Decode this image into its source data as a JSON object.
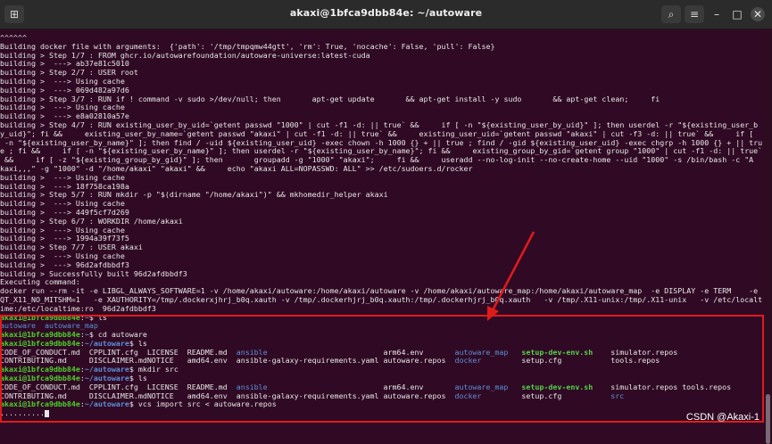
{
  "window": {
    "title": "akaxi@1bfca9dbb84e: ~/autoware"
  },
  "colors": {
    "bg": "#300a24",
    "user": "#4cd12a",
    "path": "#5d8fd9",
    "highlight": "#e01b1b"
  },
  "titlebar": {
    "new_tab_icon": "terminal-tab-icon",
    "search_icon": "search-icon",
    "menu_icon": "hamburger-menu-icon",
    "minimize_icon": "minimize-icon",
    "maximize_icon": "maximize-icon",
    "close_icon": "close-icon"
  },
  "terminal": {
    "log_lines": [
      "^^^^^^",
      "Building docker file with arguments:  {'path': '/tmp/tmpqmw44gtt', 'rm': True, 'nocache': False, 'pull': False}",
      "building > Step 1/7 : FROM ghcr.io/autowarefoundation/autoware-universe:latest-cuda",
      "building >  ---> ab37e81c5010",
      "building > Step 2/7 : USER root",
      "building >  ---> Using cache",
      "building >  ---> 069d482a97d6",
      "building > Step 3/7 : RUN if ! command -v sudo >/dev/null; then       apt-get update       && apt-get install -y sudo       && apt-get clean;     fi",
      "building >  ---> Using cache",
      "building >  ---> e8a02810a57e",
      "building > Step 4/7 : RUN existing_user_by_uid=`getent passwd \"1000\" | cut -f1 -d: || true` &&     if [ -n \"${existing_user_by_uid}\" ]; then userdel -r \"${existing_user_b",
      "y_uid}\"; fi &&     existing_user_by_name=`getent passwd \"akaxi\" | cut -f1 -d: || true` &&     existing_user_uid=`getent passwd \"akaxi\" | cut -f3 -d: || true` &&     if [",
      " -n \"${existing_user_by_name}\" ]; then find / -uid ${existing_user_uid} -exec chown -h 1000 {} + || true ; find / -gid ${existing_user_uid} -exec chgrp -h 1000 {} + || tru",
      "e ; fi &&     if [ -n \"${existing_user_by_name}\" ]; then userdel -r \"${existing_user_by_name}\"; fi &&     existing_group_by_gid=`getent group \"1000\" | cut -f1 -d: || true`",
      " &&     if [ -z \"${existing_group_by_gid}\" ]; then       groupadd -g \"1000\" \"akaxi\";     fi &&     useradd --no-log-init --no-create-home --uid \"1000\" -s /bin/bash -c \"A",
      "kaxi,,,\" -g \"1000\" -d \"/home/akaxi\" \"akaxi\" &&     echo \"akaxi ALL=NOPASSWD: ALL\" >> /etc/sudoers.d/rocker",
      "building >  ---> Using cache",
      "building >  ---> 18f758ca198a",
      "building > Step 5/7 : RUN mkdir -p \"$(dirname \"/home/akaxi\")\" && mkhomedir_helper akaxi",
      "building >  ---> Using cache",
      "building >  ---> 449f5cf7d269",
      "building > Step 6/7 : WORKDIR /home/akaxi",
      "building >  ---> Using cache",
      "building >  ---> 1994a39f73f5",
      "building > Step 7/7 : USER akaxi",
      "building >  ---> Using cache",
      "building >  ---> 96d2afdbbdf3",
      "building > Successfully built 96d2afdbbdf3",
      "Executing command:",
      "docker run --rm -it -e LIBGL_ALWAYS_SOFTWARE=1 -v /home/akaxi/autoware:/home/akaxi/autoware -v /home/akaxi/autoware_map:/home/akaxi/autoware_map  -e DISPLAY -e TERM    -e",
      "QT_X11_NO_MITSHM=1   -e XAUTHORITY=/tmp/.dockerxjhrj_b0q.xauth -v /tmp/.dockerhjrj_b0q.xauth:/tmp/.dockerhjrj_b0q.xauth   -v /tmp/.X11-unix:/tmp/.X11-unix   -v /etc/localt",
      "ime:/etc/localtime:ro  96d2afdbbdf3"
    ],
    "prompt_user": "akaxi@1bfca9dbb84e",
    "prompt_path_home": "~",
    "prompt_path_autoware": "~/autoware",
    "cmd_ls": "ls",
    "cmd_cd": "cd autoware",
    "cmd_mkdir": "mkdir src",
    "cmd_vcs": "vcs import src < autoware.repos",
    "ls_home": {
      "a": "autoware",
      "b": "autoware_map"
    },
    "ls1_row1": [
      "CODE_OF_CONDUCT.md",
      "CPPLINT.cfg",
      "LICENSE",
      "README.md",
      "ansible",
      "arm64.env",
      "autoware_map",
      "setup-dev-env.sh",
      "simulator.repos"
    ],
    "ls1_row2": [
      "CONTRIBUTING.md",
      "DISCLAIMER.md",
      "NOTICE",
      "amd64.env",
      "ansible-galaxy-requirements.yaml",
      "autoware.repos",
      "docker",
      "setup.cfg",
      "tools.repos"
    ],
    "ls2_row1": [
      "CODE_OF_CONDUCT.md",
      "CPPLINT.cfg",
      "LICENSE",
      "README.md",
      "ansible",
      "arm64.env",
      "autoware_map",
      "setup-dev-env.sh",
      "simulator.repos",
      "tools.repos"
    ],
    "ls2_row2": [
      "CONTRIBUTING.md",
      "DISCLAIMER.md",
      "NOTICE",
      "amd64.env",
      "ansible-galaxy-requirements.yaml",
      "autoware.repos",
      "docker",
      "setup.cfg",
      "src"
    ],
    "progress": ".........."
  },
  "watermark": "CSDN @Akaxi-1"
}
